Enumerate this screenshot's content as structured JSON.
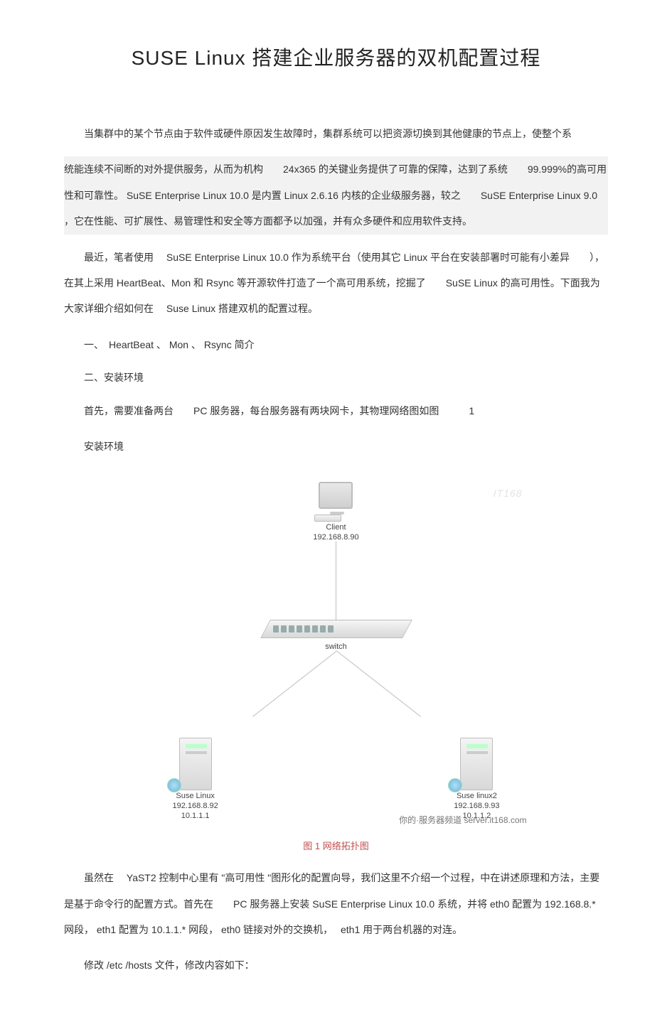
{
  "title": "SUSE Linux 搭建企业服务器的双机配置过程",
  "p1_a": "当集群中的某个节点由于软件或硬件原因发生故障时，集群系统可以把资源切换到其他健康的节点上，使整个系",
  "p1_b": "统能连续不间断的对外提供服务，从而为机构　　24x365 的关键业务提供了可靠的保障，达到了系统　　99.999%的高可用性和可靠性。 SuSE Enterprise Linux 10.0  是内置  Linux 2.6.16  内核的企业级服务器，较之　　SuSE Enterprise Linux 9.0 ，它在性能、可扩展性、易管理性和安全等方面都予以加强，并有众多硬件和应用软件支持。",
  "p2": "最近，笔者使用　 SuSE Enterprise Linux 10.0  作为系统平台（使用其它  Linux  平台在安装部署时可能有小差异　　），在其上采用  HeartBeat、Mon 和 Rsync 等开源软件打造了一个高可用系统，挖掘了　　SuSE Linux  的高可用性。下面我为大家详细介绍如何在　 Suse Linux 搭建双机的配置过程。",
  "s1": "一、　HeartBeat 、 Mon 、  Rsync  简介",
  "s2": "二、安装环境",
  "p3": "首先，需要准备两台　　PC 服务器，每台服务器有两块网卡，其物理网络图如图　　　1",
  "p4": "安装环境",
  "diagram": {
    "client_label": "Client",
    "client_ip": "192.168.8.90",
    "switch_label": "switch",
    "server_left_name": "Suse Linux",
    "server_left_ip1": "192.168.8.92",
    "server_left_ip2": "10.1.1.1",
    "server_right_name": "Suse linux2",
    "server_right_ip1": "192.168.9.93",
    "server_right_ip2": "10.1.1.2",
    "watermark": "IT168",
    "watermark2": "你的·服务器频道  server.it168.com"
  },
  "caption": "图 1  网络拓扑图",
  "p5": "虽然在　 YaST2 控制中心里有  \"高可用性 \"图形化的配置向导，我们这里不介绍一个过程，中在讲述原理和方法，主要是基于命令行的配置方式。首先在　　PC 服务器上安装  SuSE Enterprise Linux 10.0  系统，并将  eth0 配置为  192.168.8.* 网段， eth1 配置为  10.1.1.* 网段， eth0 链接对外的交换机，　 eth1 用于两台机器的对连。",
  "p6": "修改 /etc /hosts 文件，修改内容如下："
}
